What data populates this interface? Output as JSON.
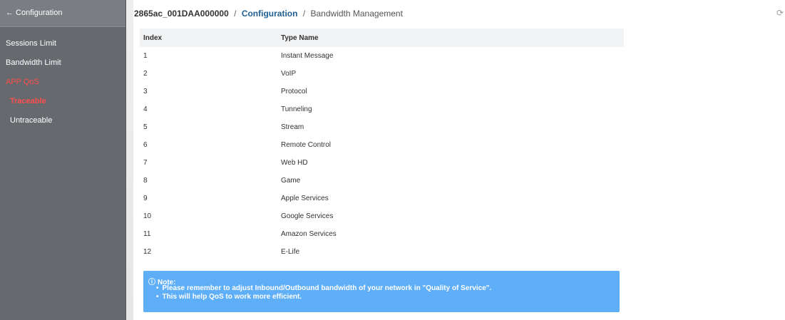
{
  "sidebar": {
    "back_label": "← Configuration",
    "items": [
      {
        "label": "Sessions Limit"
      },
      {
        "label": "Bandwidth Limit"
      },
      {
        "label": "APP QoS"
      },
      {
        "label": "Traceable"
      },
      {
        "label": "Untraceable"
      }
    ]
  },
  "breadcrumb": {
    "device": "2865ac_001DAA000000",
    "separator": "/",
    "section": "Configuration",
    "current": "Bandwidth Management"
  },
  "table": {
    "headers": {
      "index": "Index",
      "type_name": "Type Name"
    },
    "rows": [
      {
        "index": "1",
        "type_name": "Instant Message"
      },
      {
        "index": "2",
        "type_name": "VoIP"
      },
      {
        "index": "3",
        "type_name": "Protocol"
      },
      {
        "index": "4",
        "type_name": "Tunneling"
      },
      {
        "index": "5",
        "type_name": "Stream"
      },
      {
        "index": "6",
        "type_name": "Remote Control"
      },
      {
        "index": "7",
        "type_name": "Web HD"
      },
      {
        "index": "8",
        "type_name": "Game"
      },
      {
        "index": "9",
        "type_name": "Apple Services"
      },
      {
        "index": "10",
        "type_name": "Google Services"
      },
      {
        "index": "11",
        "type_name": "Amazon Services"
      },
      {
        "index": "12",
        "type_name": "E-Life"
      }
    ]
  },
  "note": {
    "icon": "ⓘ",
    "title": "Note:",
    "items": [
      "Please remember to adjust Inbound/Outbound bandwidth of your network in \"Quality of Service\".",
      "This will help QoS to work more efficient."
    ]
  },
  "icons": {
    "refresh": "refresh-icon"
  },
  "colors": {
    "sidebar_bg": "#666a6f",
    "active_item": "#ff4d4d",
    "breadcrumb_link": "#1f5f93",
    "note_bg": "#5eaef8"
  }
}
